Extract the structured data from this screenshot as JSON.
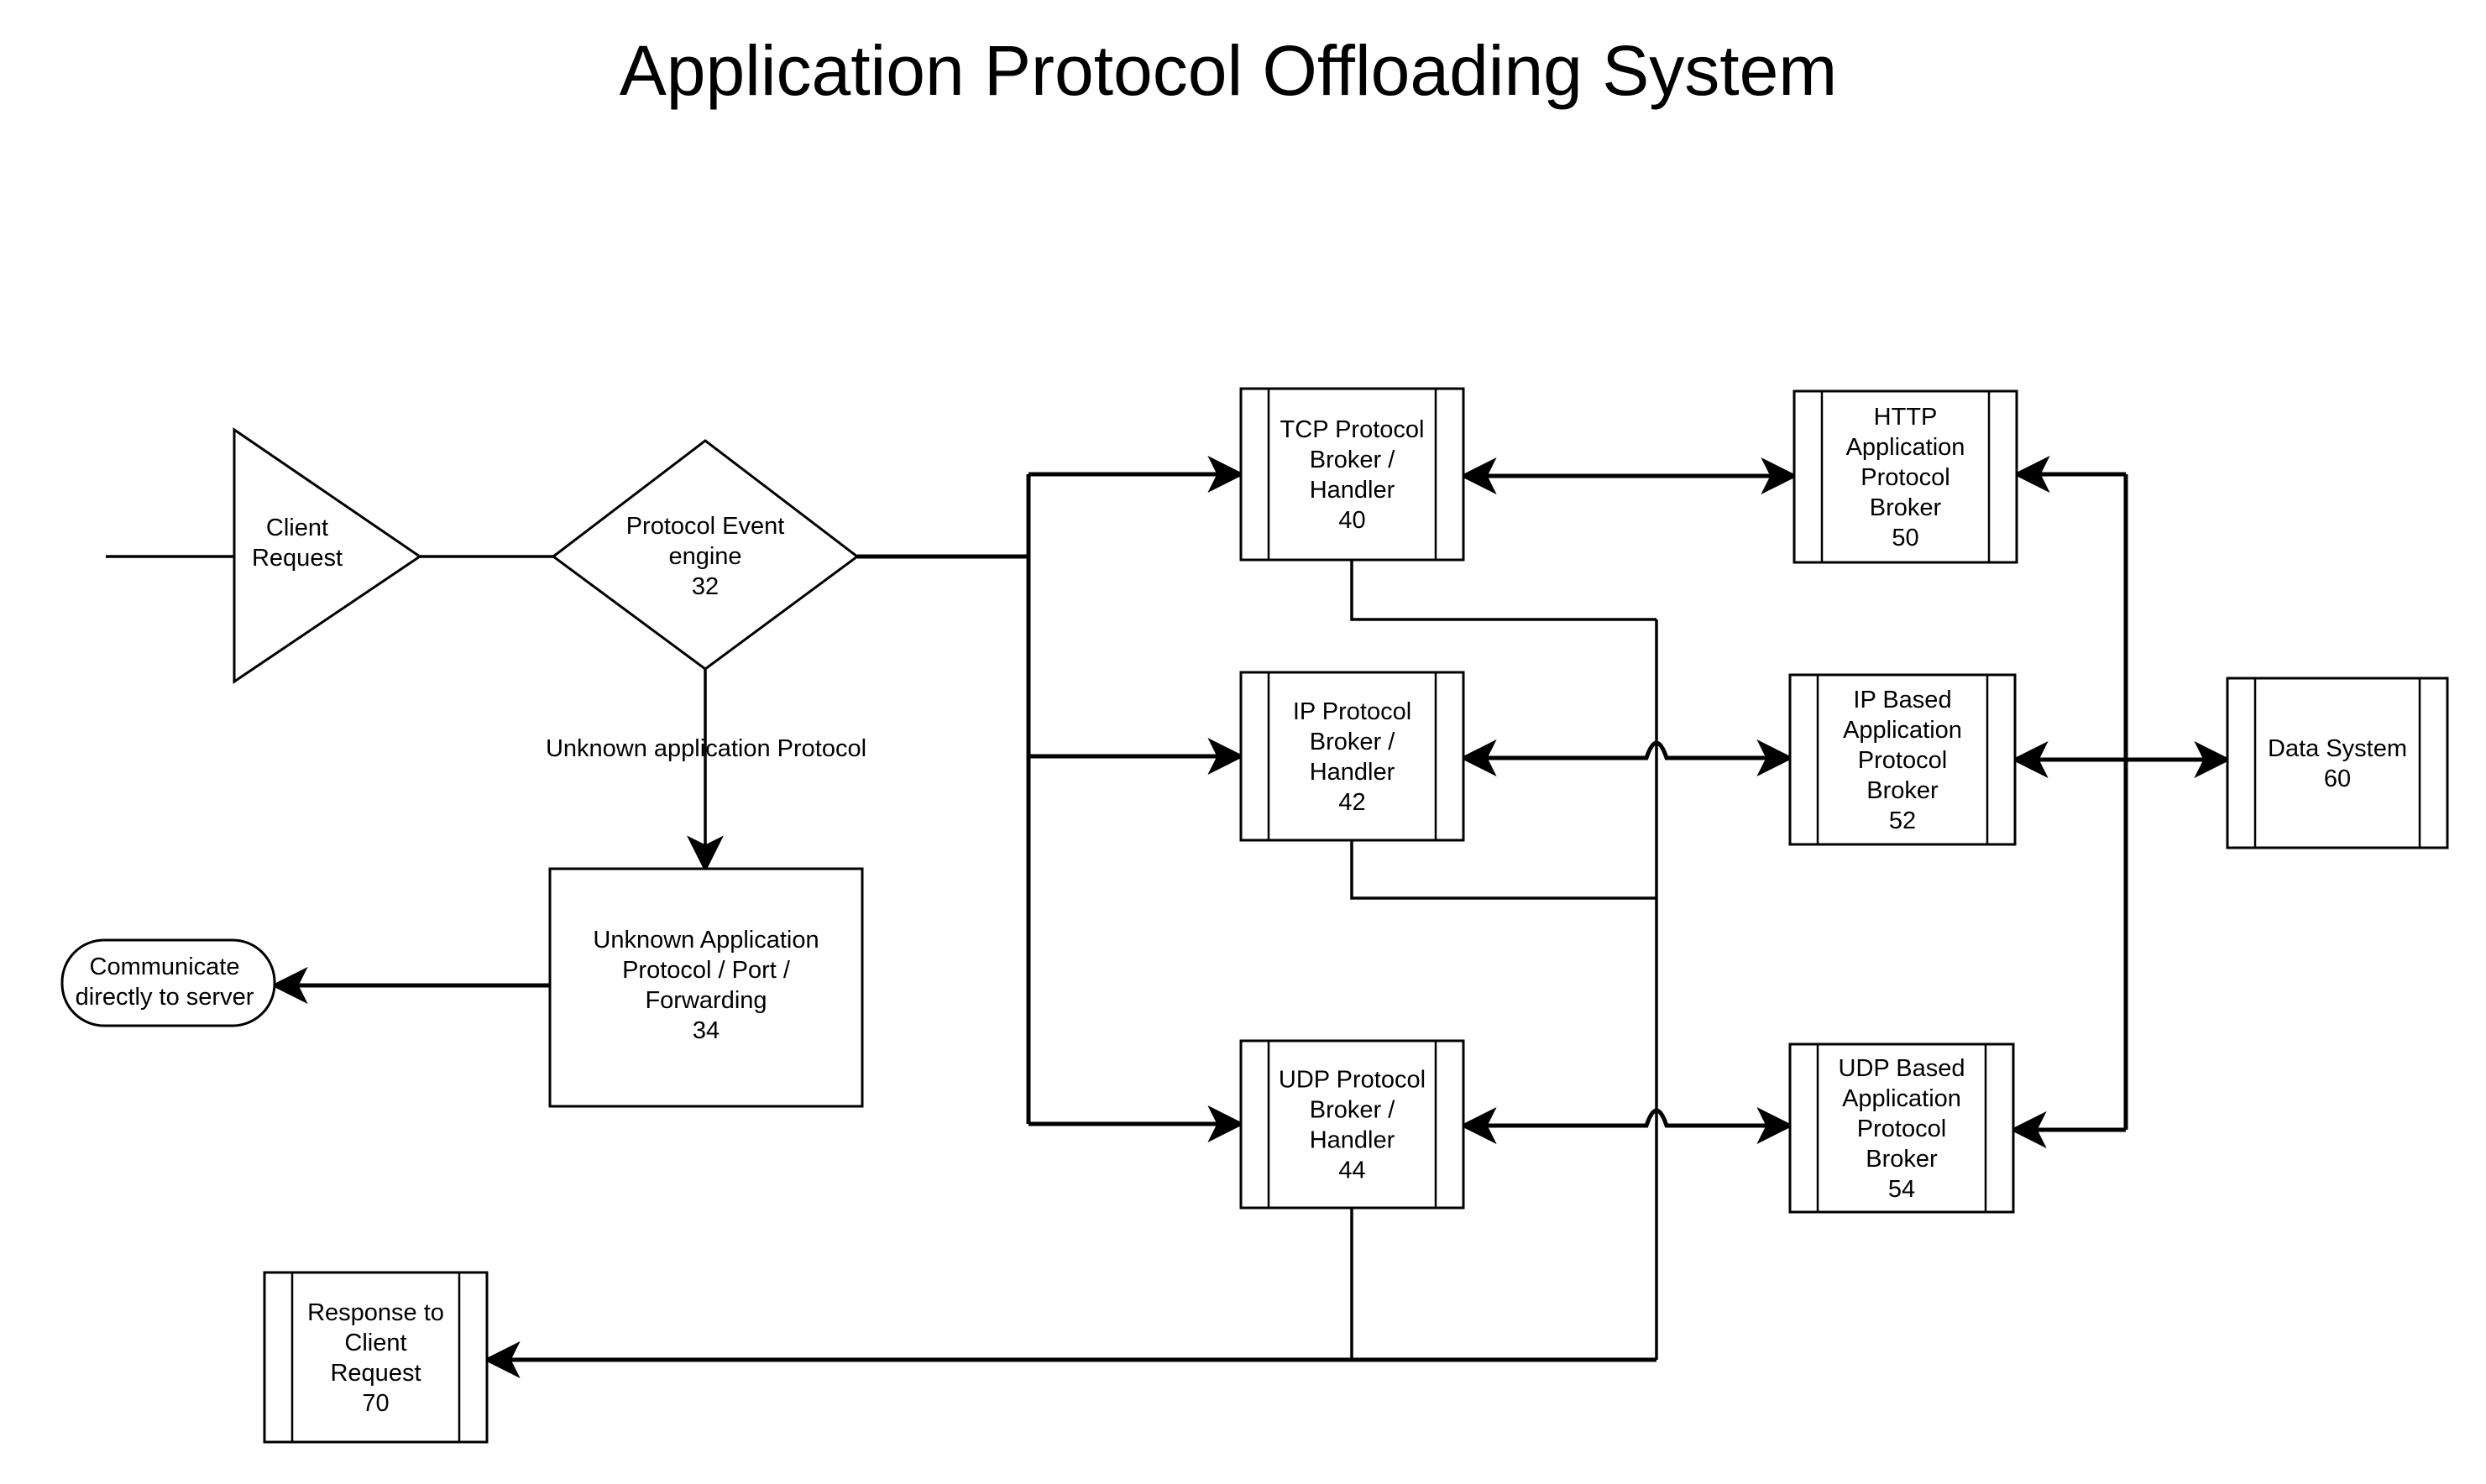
{
  "title": "Application Protocol Offloading System",
  "nodes": {
    "client_request": {
      "lines": [
        "Client",
        "Request"
      ]
    },
    "protocol_event_engine": {
      "lines": [
        "Protocol Event",
        "engine",
        "32"
      ]
    },
    "unknown_forwarding": {
      "lines": [
        "Unknown Application",
        "Protocol / Port /",
        "Forwarding",
        "34"
      ]
    },
    "communicate_direct": {
      "lines": [
        "Communicate",
        "directly to server"
      ]
    },
    "tcp_handler": {
      "lines": [
        "TCP Protocol",
        "Broker /",
        "Handler",
        "40"
      ]
    },
    "ip_handler": {
      "lines": [
        "IP Protocol",
        "Broker /",
        "Handler",
        "42"
      ]
    },
    "udp_handler": {
      "lines": [
        "UDP Protocol",
        "Broker /",
        "Handler",
        "44"
      ]
    },
    "http_broker": {
      "lines": [
        "HTTP",
        "Application",
        "Protocol",
        "Broker",
        "50"
      ]
    },
    "ip_app_broker": {
      "lines": [
        "IP Based",
        "Application",
        "Protocol",
        "Broker",
        "52"
      ]
    },
    "udp_app_broker": {
      "lines": [
        "UDP Based",
        "Application",
        "Protocol",
        "Broker",
        "54"
      ]
    },
    "data_system": {
      "lines": [
        "Data System",
        "60"
      ]
    },
    "response": {
      "lines": [
        "Response to",
        "Client",
        "Request",
        "70"
      ]
    }
  },
  "edge_labels": {
    "unknown_protocol": "Unknown application Protocol"
  }
}
